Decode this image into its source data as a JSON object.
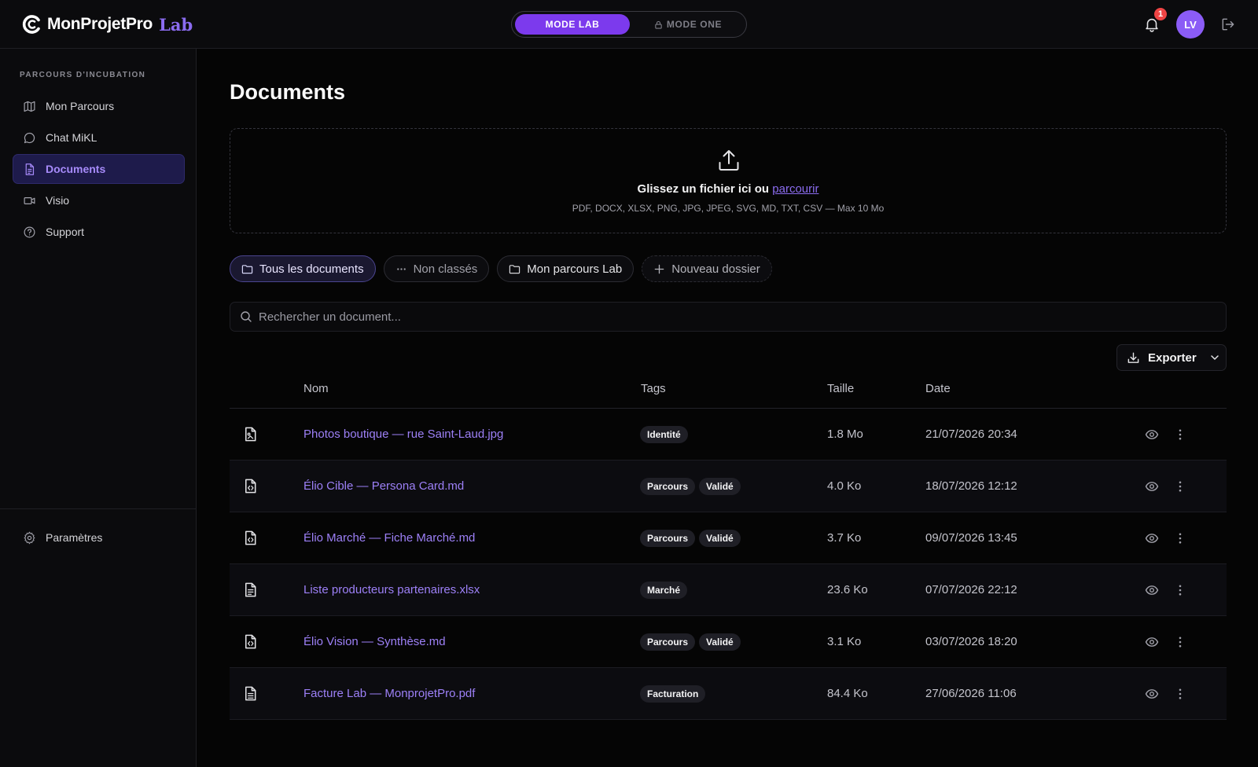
{
  "brand": {
    "name": "MonProjetPro",
    "suffix": "Lab"
  },
  "mode": {
    "active": "MODE LAB",
    "inactive": "MODE ONE"
  },
  "header": {
    "notifications": "1",
    "avatar_initials": "LV"
  },
  "sidebar": {
    "section_label": "PARCOURS D'INCUBATION",
    "items": [
      {
        "label": "Mon Parcours",
        "icon": "map-icon"
      },
      {
        "label": "Chat MiKL",
        "icon": "chat-icon"
      },
      {
        "label": "Documents",
        "icon": "document-icon"
      },
      {
        "label": "Visio",
        "icon": "video-icon"
      },
      {
        "label": "Support",
        "icon": "help-circle-icon"
      }
    ],
    "active": "Documents",
    "settings_label": "Paramètres"
  },
  "page": {
    "title": "Documents"
  },
  "dropzone": {
    "text": "Glissez un fichier ici ou",
    "link": "parcourir",
    "formats": "PDF, DOCX, XLSX, PNG, JPG, JPEG, SVG, MD, TXT, CSV — Max 10 Mo"
  },
  "folders": {
    "all": "Tous les documents",
    "unclassified": "Non classés",
    "lab": "Mon parcours Lab",
    "new": "Nouveau dossier"
  },
  "search": {
    "placeholder": "Rechercher un document..."
  },
  "export_label": "Exporter",
  "table": {
    "columns": {
      "name": "Nom",
      "tags": "Tags",
      "size": "Taille",
      "date": "Date"
    },
    "rows": [
      {
        "name": "Photos boutique — rue Saint-Laud.jpg",
        "tags": [
          "Identité"
        ],
        "size": "1.8 Mo",
        "date": "21/07/2026 20:34",
        "icon": "image-file-icon"
      },
      {
        "name": "Élio Cible — Persona Card.md",
        "tags": [
          "Parcours",
          "Validé"
        ],
        "size": "4.0 Ko",
        "date": "18/07/2026 12:12",
        "icon": "code-file-icon"
      },
      {
        "name": "Élio Marché — Fiche Marché.md",
        "tags": [
          "Parcours",
          "Validé"
        ],
        "size": "3.7 Ko",
        "date": "09/07/2026 13:45",
        "icon": "code-file-icon"
      },
      {
        "name": "Liste producteurs partenaires.xlsx",
        "tags": [
          "Marché"
        ],
        "size": "23.6 Ko",
        "date": "07/07/2026 22:12",
        "icon": "spreadsheet-file-icon"
      },
      {
        "name": "Élio Vision — Synthèse.md",
        "tags": [
          "Parcours",
          "Validé"
        ],
        "size": "3.1 Ko",
        "date": "03/07/2026 18:20",
        "icon": "code-file-icon"
      },
      {
        "name": "Facture Lab — MonprojetPro.pdf",
        "tags": [
          "Facturation"
        ],
        "size": "84.4 Ko",
        "date": "27/06/2026 11:06",
        "icon": "text-file-icon"
      }
    ]
  },
  "colors": {
    "accent": "#7c3aed",
    "link": "#9d80f7",
    "badge": "#ef4444",
    "background": "#050505"
  }
}
